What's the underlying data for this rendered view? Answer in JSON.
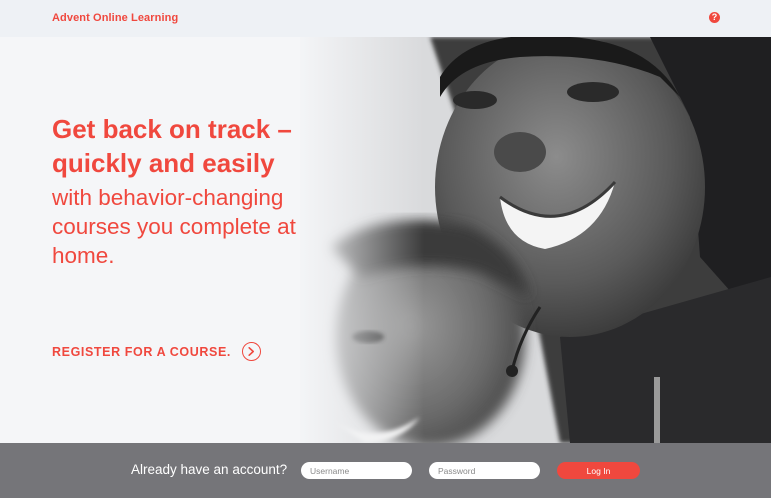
{
  "header": {
    "brand": "Advent Online Learning",
    "help_icon": "question-circle-icon"
  },
  "hero": {
    "headline_line1": "Get back on track –",
    "headline_line2": "quickly and easily",
    "subhead": "with behavior-changing courses you complete at home.",
    "register_label": "REGISTER FOR A COURSE.",
    "register_icon": "chevron-right-circle-icon",
    "photo_description_icon": "hero-photo"
  },
  "login": {
    "prompt": "Already have an account?",
    "username_placeholder": "Username",
    "password_placeholder": "Password",
    "button_label": "Log In"
  },
  "colors": {
    "accent": "#f0483e",
    "login_bar": "#606064",
    "header_bg": "#eef1f5"
  }
}
